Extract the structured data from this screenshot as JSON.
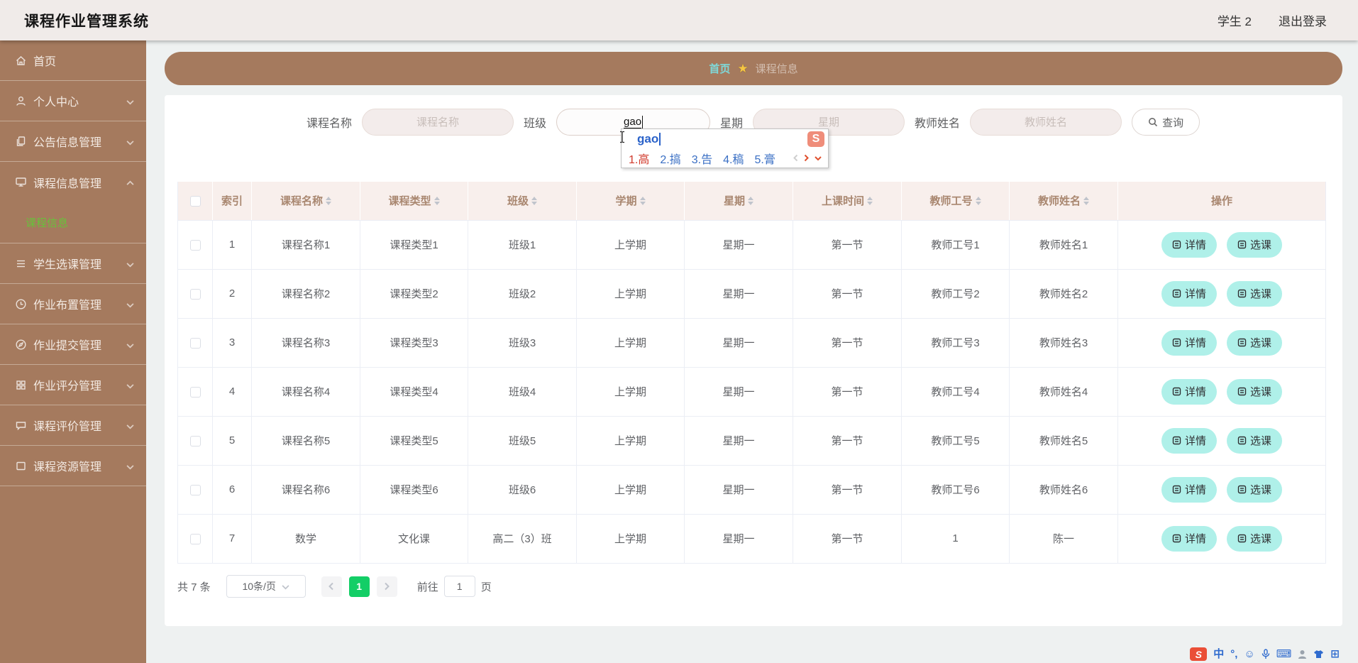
{
  "app": {
    "title": "课程作业管理系统",
    "user": "学生 2",
    "logout": "退出登录"
  },
  "sidebar": {
    "items": [
      {
        "label": "首页",
        "icon": "home"
      },
      {
        "label": "个人中心",
        "icon": "user"
      },
      {
        "label": "公告信息管理",
        "icon": "copy-document"
      },
      {
        "label": "课程信息管理",
        "icon": "monitor",
        "children": [
          {
            "label": "课程信息",
            "active": true
          }
        ]
      },
      {
        "label": "学生选课管理",
        "icon": "list"
      },
      {
        "label": "作业布置管理",
        "icon": "clock"
      },
      {
        "label": "作业提交管理",
        "icon": "compass"
      },
      {
        "label": "作业评分管理",
        "icon": "grid"
      },
      {
        "label": "课程评价管理",
        "icon": "chat"
      },
      {
        "label": "课程资源管理",
        "icon": "board"
      }
    ]
  },
  "breadcrumb": {
    "home": "首页",
    "separator_icon": "star",
    "current": "课程信息"
  },
  "search": {
    "fields": [
      {
        "label": "课程名称",
        "placeholder": "课程名称",
        "value": ""
      },
      {
        "label": "班级",
        "placeholder": "班级",
        "value": "gao",
        "focused": true
      },
      {
        "label": "星期",
        "placeholder": "星期",
        "value": ""
      },
      {
        "label": "教师姓名",
        "placeholder": "教师姓名",
        "value": ""
      }
    ],
    "submit_label": "查询"
  },
  "ime": {
    "composition": "gao",
    "candidates": [
      "1.高",
      "2.搞",
      "3.告",
      "4.稿",
      "5.膏"
    ],
    "logo_text": "S"
  },
  "table": {
    "columns": [
      {
        "label": "索引",
        "sortable": false
      },
      {
        "label": "课程名称",
        "sortable": true
      },
      {
        "label": "课程类型",
        "sortable": true
      },
      {
        "label": "班级",
        "sortable": true
      },
      {
        "label": "学期",
        "sortable": true
      },
      {
        "label": "星期",
        "sortable": true
      },
      {
        "label": "上课时间",
        "sortable": true
      },
      {
        "label": "教师工号",
        "sortable": true
      },
      {
        "label": "教师姓名",
        "sortable": true
      },
      {
        "label": "操作",
        "sortable": false
      }
    ],
    "rows": [
      {
        "index": "1",
        "name": "课程名称1",
        "type": "课程类型1",
        "class": "班级1",
        "semester": "上学期",
        "week": "星期一",
        "time": "第一节",
        "teacher_id": "教师工号1",
        "teacher": "教师姓名1"
      },
      {
        "index": "2",
        "name": "课程名称2",
        "type": "课程类型2",
        "class": "班级2",
        "semester": "上学期",
        "week": "星期一",
        "time": "第一节",
        "teacher_id": "教师工号2",
        "teacher": "教师姓名2"
      },
      {
        "index": "3",
        "name": "课程名称3",
        "type": "课程类型3",
        "class": "班级3",
        "semester": "上学期",
        "week": "星期一",
        "time": "第一节",
        "teacher_id": "教师工号3",
        "teacher": "教师姓名3"
      },
      {
        "index": "4",
        "name": "课程名称4",
        "type": "课程类型4",
        "class": "班级4",
        "semester": "上学期",
        "week": "星期一",
        "time": "第一节",
        "teacher_id": "教师工号4",
        "teacher": "教师姓名4"
      },
      {
        "index": "5",
        "name": "课程名称5",
        "type": "课程类型5",
        "class": "班级5",
        "semester": "上学期",
        "week": "星期一",
        "time": "第一节",
        "teacher_id": "教师工号5",
        "teacher": "教师姓名5"
      },
      {
        "index": "6",
        "name": "课程名称6",
        "type": "课程类型6",
        "class": "班级6",
        "semester": "上学期",
        "week": "星期一",
        "time": "第一节",
        "teacher_id": "教师工号6",
        "teacher": "教师姓名6"
      },
      {
        "index": "7",
        "name": "数学",
        "type": "文化课",
        "class": "高二（3）班",
        "semester": "上学期",
        "week": "星期一",
        "time": "第一节",
        "teacher_id": "1",
        "teacher": "陈一"
      }
    ],
    "actions": [
      "详情",
      "选课"
    ]
  },
  "pagination": {
    "total": "共 7 条",
    "page_size": "10条/页",
    "page": "1",
    "goto_label": "前往",
    "goto_value": "1",
    "page_unit": "页"
  },
  "taskbar": {
    "logo": "S",
    "mode": "中",
    "punct": "°,",
    "emoji": "☺",
    "keyboard": "⌨",
    "toolbox": "⊞"
  },
  "colors": {
    "brand_brown": "#a57a5e",
    "header_bg": "#f0ebe9",
    "active_menu_green": "#67c23a",
    "breadcrumb_link_cyan": "#7fd8d8",
    "table_header_bg": "#f8efec",
    "table_header_text": "#a98770",
    "action_button_bg": "#aff0e9",
    "pager_active_green": "#13ce66",
    "candidate_red": "#d0392b",
    "candidate_blue": "#3a6fc4",
    "sogou_salmon": "#ef8d7a"
  }
}
